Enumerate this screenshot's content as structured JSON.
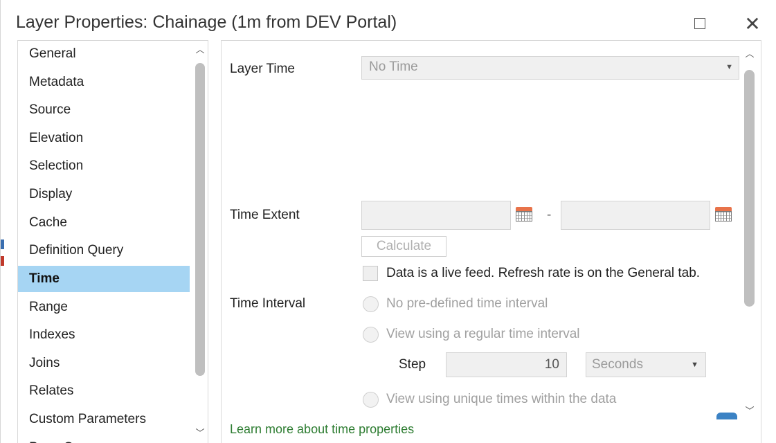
{
  "window": {
    "title": "Layer Properties: Chainage (1m from DEV Portal)",
    "maximize_icon": "maximize-icon",
    "close_icon": "close-icon"
  },
  "nav": {
    "items": [
      {
        "label": "General"
      },
      {
        "label": "Metadata"
      },
      {
        "label": "Source"
      },
      {
        "label": "Elevation"
      },
      {
        "label": "Selection"
      },
      {
        "label": "Display"
      },
      {
        "label": "Cache"
      },
      {
        "label": "Definition Query"
      },
      {
        "label": "Time",
        "selected": true
      },
      {
        "label": "Range"
      },
      {
        "label": "Indexes"
      },
      {
        "label": "Joins"
      },
      {
        "label": "Relates"
      },
      {
        "label": "Custom Parameters"
      },
      {
        "label": "Page Query"
      }
    ]
  },
  "time": {
    "layer_time_label": "Layer Time",
    "layer_time_value": "No Time",
    "time_extent_label": "Time Extent",
    "extent_separator": "-",
    "calculate_label": "Calculate",
    "live_feed_label": "Data is a live feed. Refresh rate is on the General tab.",
    "time_interval_label": "Time Interval",
    "interval_options": [
      "No pre-defined time interval",
      "View using a regular time interval",
      "View using unique times within the data"
    ],
    "step_label": "Step",
    "step_value": "10",
    "step_unit": "Seconds",
    "learn_more": "Learn more about time properties"
  },
  "colors": {
    "selected_nav": "#a6d5f3",
    "link": "#2e7d32",
    "calendar_accent": "#e8734a"
  }
}
